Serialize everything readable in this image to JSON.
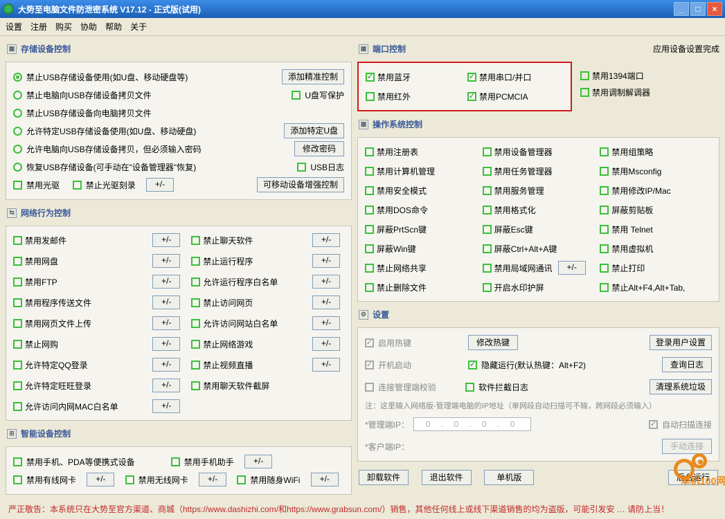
{
  "window": {
    "title": "大势至电脑文件防泄密系统 V17.12 - 正式版(试用)"
  },
  "menu": [
    "设置",
    "注册",
    "购买",
    "协助",
    "帮助",
    "关于"
  ],
  "status_right": "应用设备设置完成",
  "sections": {
    "storage_title": "存储设备控制",
    "network_title": "网络行为控制",
    "smart_title": "智能设备控制",
    "port_title": "端口控制",
    "os_title": "操作系统控制",
    "settings_title": "设置"
  },
  "storage": {
    "r1": "禁止USB存储设备使用(如U盘、移动硬盘等)",
    "r2": "禁止电脑向USB存储设备拷贝文件",
    "r3": "禁止USB存储设备向电脑拷贝文件",
    "r4": "允许特定USB存储设备使用(如U盘、移动硬盘)",
    "r5": "允许电脑向USB存储设备拷贝，但必须输入密码",
    "r6": "恢复USB存储设备(可手动在\"设备管理器\"恢复)",
    "b1": "添加精准控制",
    "c_udisk_protect": "U盘写保护",
    "b2": "添加特定U盘",
    "b3": "修改密码",
    "c_usblog": "USB日志",
    "c_opt": "禁用光驱",
    "c_burn": "禁止光驱刻录",
    "b4": "可移动设备增强控制"
  },
  "network": {
    "left": [
      "禁用发邮件",
      "禁用网盘",
      "禁用FTP",
      "禁用程序传送文件",
      "禁用网页文件上传",
      "禁止网购",
      "允许特定QQ登录",
      "允许特定旺旺登录",
      "允许访问内网MAC白名单"
    ],
    "right": [
      "禁止聊天软件",
      "禁止运行程序",
      "允许运行程序白名单",
      "禁止访问网页",
      "允许访问网站白名单",
      "禁止网络游戏",
      "禁止视频直播",
      "禁用聊天软件截屏"
    ]
  },
  "smart": {
    "c1": "禁用手机、PDA等便携式设备",
    "c2": "禁用手机助手",
    "c3": "禁用有线网卡",
    "c4": "禁用无线网卡",
    "c5": "禁用随身WiFi"
  },
  "port": {
    "c1": "禁用蓝牙",
    "c2": "禁用串口/并口",
    "c3": "禁用1394端口",
    "c4": "禁用红外",
    "c5": "禁用PCMCIA",
    "c6": "禁用调制解调器"
  },
  "os": {
    "items": [
      "禁用注册表",
      "禁用设备管理器",
      "禁用组策略",
      "禁用计算机管理",
      "禁用任务管理器",
      "禁用Msconfig",
      "禁用安全模式",
      "禁用服务管理",
      "禁用修改IP/Mac",
      "禁用DOS命令",
      "禁用格式化",
      "屏蔽剪贴板",
      "屏蔽PrtScn键",
      "屏蔽Esc键",
      "禁用 Telnet",
      "屏蔽Win键",
      "屏蔽Ctrl+Alt+A键",
      "禁用虚拟机",
      "禁止网络共享",
      "禁用局域网通讯",
      "禁止打印",
      "禁止删除文件",
      "开启水印护屏",
      "禁止Alt+F4,Alt+Tab,"
    ],
    "pm_index": 19
  },
  "settings": {
    "enable_hotkey": "启用热键",
    "btn_modify_hotkey": "修改热键",
    "btn_login_settings": "登录用户设置",
    "autostart": "开机启动",
    "hidden_run": "隐藏运行(默认热键：Alt+F2)",
    "btn_query_log": "查询日志",
    "conn_mgmt": "连接管理端校验",
    "soft_block_log": "软件拦截日志",
    "btn_clean": "清理系统垃圾",
    "note": "注：这里输入网络版-管理端电脑的IP地址（单网段自动扫描可不输，跨网段必须输入）",
    "mgmt_ip_label": "*管理端IP：",
    "ip_placeholder": "0 . 0 . 0 . 0",
    "auto_scan": "自动扫描连接",
    "client_ip_label": "*客户端IP：",
    "btn_manual": "手动连接"
  },
  "bottom_buttons": {
    "uninstall": "卸载软件",
    "exit": "退出软件",
    "single": "单机版",
    "background": "后台运行"
  },
  "footer": "严正敬告：本系统只在大势至官方渠道、商城（https://www.dashizhi.com/和https://www.grabsun.com/）销售，其他任何线上或线下渠道销售的均为盗版，可能引发安 … 请防上当！",
  "pm": "+/-",
  "logo_text": "单机100网"
}
